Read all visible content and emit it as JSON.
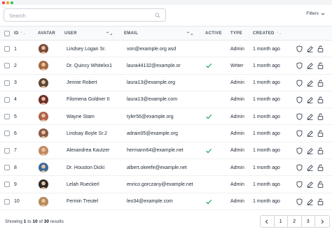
{
  "search": {
    "placeholder": "Search"
  },
  "toolbar": {
    "filters_label": "Filters"
  },
  "columns": {
    "id": "ID",
    "avatar": "AVATAR",
    "user": "USER",
    "email": "EMAIL",
    "active": "ACTIVE",
    "type": "TYPE",
    "created": "CREATED"
  },
  "rows": [
    {
      "id": "1",
      "user": "Lindsey Logan Sr.",
      "email": "von@example.org asd",
      "active": false,
      "type": "Admin",
      "created": "1 month ago",
      "avatar_bg": "#7c4a3a"
    },
    {
      "id": "2",
      "user": "Dr. Quincy Whitelxx1",
      "email": "laura44132@example.or",
      "active": true,
      "type": "Writer",
      "created": "1 month ago",
      "avatar_bg": "#a1683f"
    },
    {
      "id": "3",
      "user": "Jennie Robert",
      "email": "laura13@example.org",
      "active": false,
      "type": "Admin",
      "created": "1 month ago",
      "avatar_bg": "#5b4636"
    },
    {
      "id": "4",
      "user": "Filomena Goldner II",
      "email": "laura13@example.com",
      "active": false,
      "type": "Admin",
      "created": "1 month ago",
      "avatar_bg": "#6d2e2a"
    },
    {
      "id": "5",
      "user": "Wayne Stam",
      "email": "tyler56@example.org",
      "active": true,
      "type": "Admin",
      "created": "1 month ago",
      "avatar_bg": "#b0604a"
    },
    {
      "id": "6",
      "user": "Lindsay Boyle Sr.2",
      "email": "adrain05@example.org",
      "active": false,
      "type": "Admin",
      "created": "1 month ago",
      "avatar_bg": "#8a5a44"
    },
    {
      "id": "7",
      "user": "Alexandrea Kautzer",
      "email": "hermann64@example.net",
      "active": true,
      "type": "Admin",
      "created": "1 month ago",
      "avatar_bg": "#c08a62"
    },
    {
      "id": "8",
      "user": "Dr. Houston Dicki",
      "email": "albert.okeefe@example.net",
      "active": false,
      "type": "Admin",
      "created": "1 month ago",
      "avatar_bg": "#3b6a9a"
    },
    {
      "id": "9",
      "user": "Lelah Rueckerl",
      "email": "enrico.gorczany@example.net",
      "active": false,
      "type": "Admin",
      "created": "1 month ago",
      "avatar_bg": "#2f2a28"
    },
    {
      "id": "10",
      "user": "Fermin Treutel",
      "email": "leo34@example.com",
      "active": true,
      "type": "Admin",
      "created": "1 month ago",
      "avatar_bg": "#b58a5a"
    }
  ],
  "footer": {
    "showing_prefix": "Showing",
    "from": "1",
    "to_word": "to",
    "to": "10",
    "of_word": "of",
    "total": "30",
    "results_word": "results"
  },
  "pagination": {
    "pages": [
      "1",
      "2",
      "3"
    ],
    "prev_icon": "chevron-left-icon",
    "next_icon": "chevron-right-icon"
  },
  "row_actions": [
    "shield-icon",
    "edit-pencil-icon",
    "lock-icon"
  ],
  "colors": {
    "active_check": "#22a35a",
    "header_bg": "#f9fafb",
    "border": "#e5e7eb"
  }
}
